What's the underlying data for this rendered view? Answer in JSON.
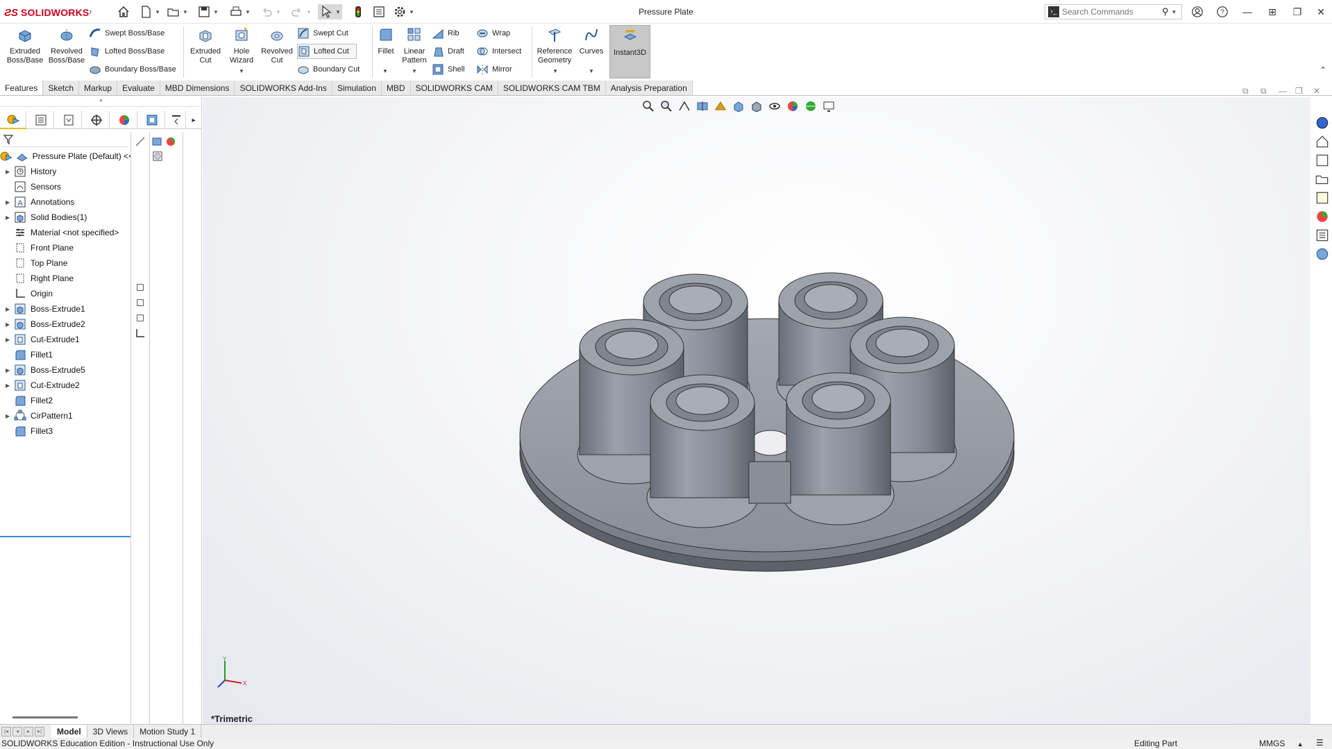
{
  "app": {
    "brand": "SOLIDWORKS",
    "document_title": "Pressure Plate"
  },
  "search": {
    "placeholder": "Search Commands"
  },
  "ribbon": {
    "features": {
      "extruded_boss": "Extruded Boss/Base",
      "revolved_boss": "Revolved Boss/Base",
      "swept_boss": "Swept Boss/Base",
      "lofted_boss": "Lofted Boss/Base",
      "boundary_boss": "Boundary Boss/Base",
      "extruded_cut": "Extruded Cut",
      "hole_wizard": "Hole Wizard",
      "revolved_cut": "Revolved Cut",
      "swept_cut": "Swept Cut",
      "lofted_cut": "Lofted Cut",
      "boundary_cut": "Boundary Cut",
      "fillet": "Fillet",
      "linear_pattern": "Linear Pattern",
      "rib": "Rib",
      "draft": "Draft",
      "shell": "Shell",
      "wrap": "Wrap",
      "intersect": "Intersect",
      "mirror": "Mirror",
      "reference_geometry": "Reference Geometry",
      "curves": "Curves",
      "instant3d": "Instant3D"
    }
  },
  "tabs": [
    "Features",
    "Sketch",
    "Markup",
    "Evaluate",
    "MBD Dimensions",
    "SOLIDWORKS Add-Ins",
    "Simulation",
    "MBD",
    "SOLIDWORKS CAM",
    "SOLIDWORKS CAM TBM",
    "Analysis Preparation"
  ],
  "feature_tree": {
    "root": "Pressure Plate (Default) <<",
    "items": [
      {
        "label": "History",
        "icon": "history-icon",
        "expandable": true
      },
      {
        "label": "Sensors",
        "icon": "sensors-icon",
        "expandable": false
      },
      {
        "label": "Annotations",
        "icon": "annotations-icon",
        "expandable": true
      },
      {
        "label": "Solid Bodies(1)",
        "icon": "solid-bodies-icon",
        "expandable": true
      },
      {
        "label": "Material <not specified>",
        "icon": "material-icon",
        "expandable": false
      },
      {
        "label": "Front Plane",
        "icon": "plane-icon",
        "expandable": false
      },
      {
        "label": "Top Plane",
        "icon": "plane-icon",
        "expandable": false
      },
      {
        "label": "Right Plane",
        "icon": "plane-icon",
        "expandable": false
      },
      {
        "label": "Origin",
        "icon": "origin-icon",
        "expandable": false
      },
      {
        "label": "Boss-Extrude1",
        "icon": "boss-extrude-icon",
        "expandable": true
      },
      {
        "label": "Boss-Extrude2",
        "icon": "boss-extrude-icon",
        "expandable": true
      },
      {
        "label": "Cut-Extrude1",
        "icon": "cut-extrude-icon",
        "expandable": true
      },
      {
        "label": "Fillet1",
        "icon": "fillet-icon",
        "expandable": false
      },
      {
        "label": "Boss-Extrude5",
        "icon": "boss-extrude-icon",
        "expandable": true
      },
      {
        "label": "Cut-Extrude2",
        "icon": "cut-extrude-icon",
        "expandable": true
      },
      {
        "label": "Fillet2",
        "icon": "fillet-icon",
        "expandable": false
      },
      {
        "label": "CirPattern1",
        "icon": "circular-pattern-icon",
        "expandable": true
      },
      {
        "label": "Fillet3",
        "icon": "fillet-icon",
        "expandable": false
      }
    ]
  },
  "viewport": {
    "view_label": "*Trimetric",
    "triad": {
      "x": "X",
      "y": "Y"
    }
  },
  "bottom_tabs": [
    "Model",
    "3D Views",
    "Motion Study 1"
  ],
  "status": {
    "left": "SOLIDWORKS Education Edition - Instructional Use Only",
    "mode": "Editing Part",
    "units": "MMGS"
  },
  "colors": {
    "brand_red": "#d0021b",
    "part_gray": "#8f939d",
    "selection_blue": "#3d8fd6"
  }
}
